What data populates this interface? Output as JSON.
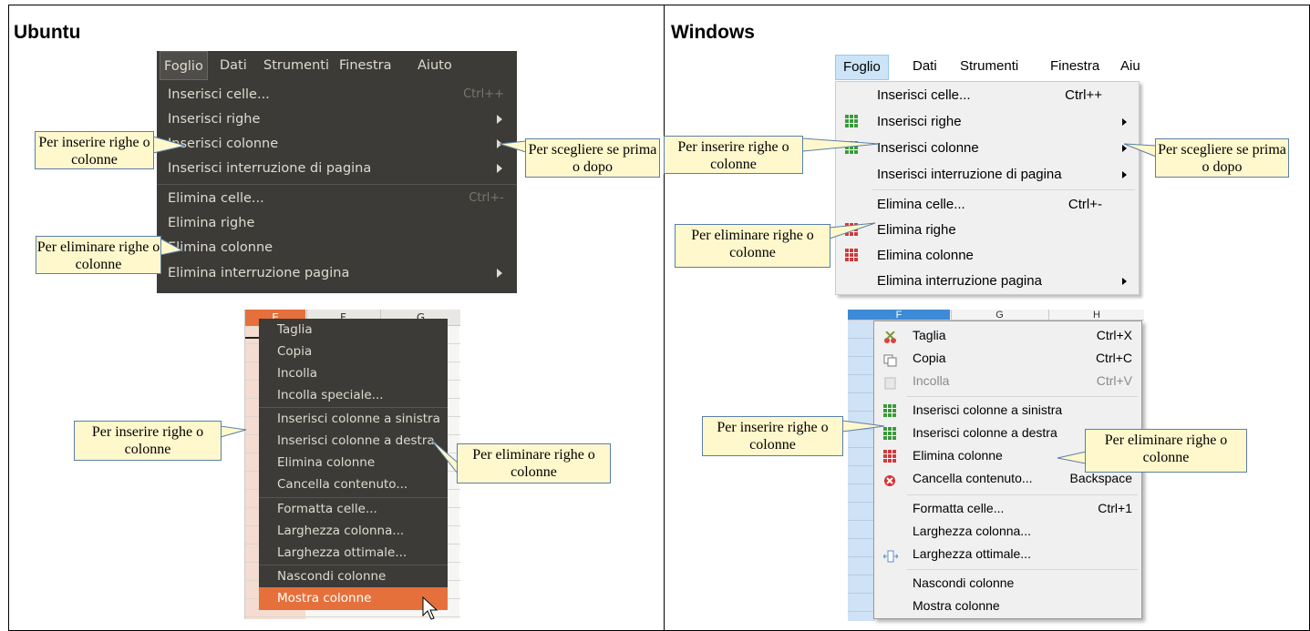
{
  "titles": {
    "left": "Ubuntu",
    "right": "Windows"
  },
  "ubuntu": {
    "menubar": [
      "Foglio",
      "Dati",
      "Strumenti",
      "Finestra",
      "Aiuto"
    ],
    "menu": [
      {
        "label": "Inserisci celle...",
        "shortcut": "Ctrl++",
        "submenu": false
      },
      {
        "label": "Inserisci righe",
        "shortcut": "",
        "submenu": true
      },
      {
        "label": "Inserisci colonne",
        "shortcut": "",
        "submenu": true
      },
      {
        "label": "Inserisci interruzione di pagina",
        "shortcut": "",
        "submenu": true
      },
      {
        "label": "Elimina celle...",
        "shortcut": "Ctrl+-",
        "submenu": false
      },
      {
        "label": "Elimina righe",
        "shortcut": "",
        "submenu": false
      },
      {
        "label": "Elimina colonne",
        "shortcut": "",
        "submenu": false
      },
      {
        "label": "Elimina interruzione pagina",
        "shortcut": "",
        "submenu": true
      }
    ],
    "column_headers": [
      "E",
      "F",
      "G"
    ],
    "context_menu": [
      "Taglia",
      "Copia",
      "Incolla",
      "Incolla speciale...",
      "Inserisci colonne a sinistra",
      "Inserisci colonne a destra",
      "Elimina colonne",
      "Cancella contenuto...",
      "Formatta celle...",
      "Larghezza colonna...",
      "Larghezza ottimale...",
      "Nascondi colonne",
      "Mostra colonne"
    ]
  },
  "windows": {
    "menubar": [
      "Foglio",
      "Dati",
      "Strumenti",
      "Finestra",
      "Aiu"
    ],
    "menu": [
      {
        "label": "Inserisci celle...",
        "shortcut": "Ctrl++",
        "submenu": false,
        "icon": ""
      },
      {
        "label": "Inserisci righe",
        "shortcut": "",
        "submenu": true,
        "icon": "insert-rows-icon"
      },
      {
        "label": "Inserisci colonne",
        "shortcut": "",
        "submenu": true,
        "icon": "insert-columns-icon"
      },
      {
        "label": "Inserisci interruzione di pagina",
        "shortcut": "",
        "submenu": true,
        "icon": ""
      },
      {
        "label": "Elimina celle...",
        "shortcut": "Ctrl+-",
        "submenu": false,
        "icon": ""
      },
      {
        "label": "Elimina righe",
        "shortcut": "",
        "submenu": false,
        "icon": "delete-rows-icon"
      },
      {
        "label": "Elimina colonne",
        "shortcut": "",
        "submenu": false,
        "icon": "delete-columns-icon"
      },
      {
        "label": "Elimina interruzione pagina",
        "shortcut": "",
        "submenu": true,
        "icon": ""
      }
    ],
    "column_headers": [
      "F",
      "G",
      "H"
    ],
    "context_menu": [
      {
        "label": "Taglia",
        "shortcut": "Ctrl+X",
        "icon": "scissors-icon",
        "disabled": false
      },
      {
        "label": "Copia",
        "shortcut": "Ctrl+C",
        "icon": "copy-icon",
        "disabled": false
      },
      {
        "label": "Incolla",
        "shortcut": "Ctrl+V",
        "icon": "paste-icon",
        "disabled": true
      },
      {
        "label": "Inserisci colonne a sinistra",
        "shortcut": "",
        "icon": "insert-columns-left-icon",
        "disabled": false
      },
      {
        "label": "Inserisci colonne a destra",
        "shortcut": "",
        "icon": "insert-columns-right-icon",
        "disabled": false
      },
      {
        "label": "Elimina colonne",
        "shortcut": "",
        "icon": "delete-columns-icon",
        "disabled": false
      },
      {
        "label": "Cancella contenuto...",
        "shortcut": "Backspace",
        "icon": "clear-contents-icon",
        "disabled": false
      },
      {
        "label": "Formatta celle...",
        "shortcut": "Ctrl+1",
        "icon": "",
        "disabled": false
      },
      {
        "label": "Larghezza colonna...",
        "shortcut": "",
        "icon": "",
        "disabled": false
      },
      {
        "label": "Larghezza ottimale...",
        "shortcut": "",
        "icon": "optimal-width-icon",
        "disabled": false
      },
      {
        "label": "Nascondi colonne",
        "shortcut": "",
        "icon": "",
        "disabled": false
      },
      {
        "label": "Mostra colonne",
        "shortcut": "",
        "icon": "",
        "disabled": false
      }
    ]
  },
  "callouts": {
    "insert": "Per inserire righe o colonne",
    "choose": "Per scegliere se prima o dopo",
    "delete": "Per eliminare righe o colonne"
  },
  "colors": {
    "ubuntu_menu": "#3c3b37",
    "ubuntu_highlight": "#e5703c",
    "callout_fill": "#fff8cc",
    "windows_menu": "#f0f0f0"
  }
}
